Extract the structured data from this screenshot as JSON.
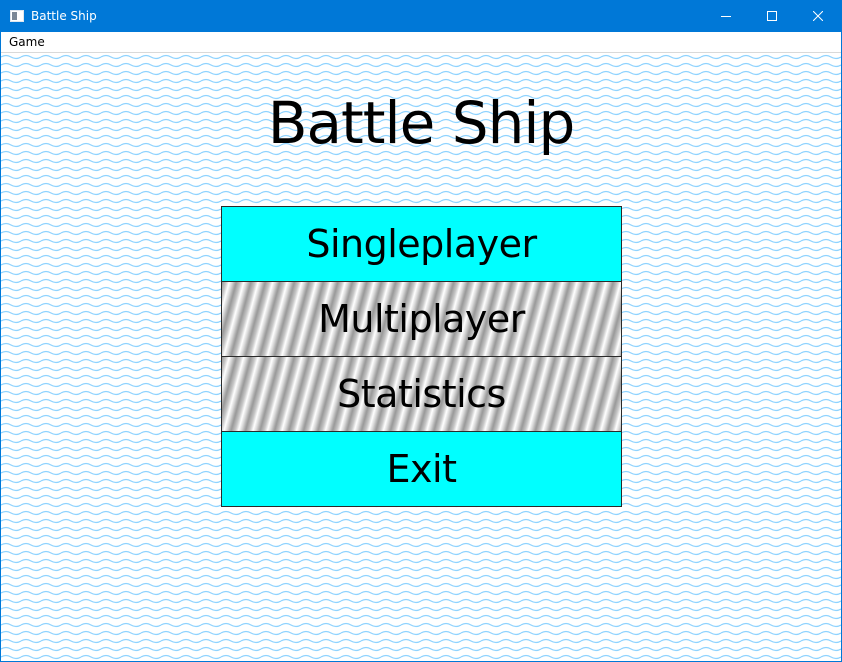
{
  "window": {
    "title": "Battle Ship",
    "icon": "app-window-icon",
    "controls": [
      "minimize-icon",
      "maximize-icon",
      "close-icon"
    ],
    "accent_color": "#0078d7"
  },
  "menubar": {
    "items": [
      {
        "label": "Game"
      }
    ]
  },
  "main": {
    "title": "Battle Ship",
    "background": "water-waves",
    "menu": [
      {
        "label": "Singleplayer",
        "style": "cyan"
      },
      {
        "label": "Multiplayer",
        "style": "metal"
      },
      {
        "label": "Statistics",
        "style": "metal"
      },
      {
        "label": "Exit",
        "style": "cyan"
      }
    ]
  }
}
